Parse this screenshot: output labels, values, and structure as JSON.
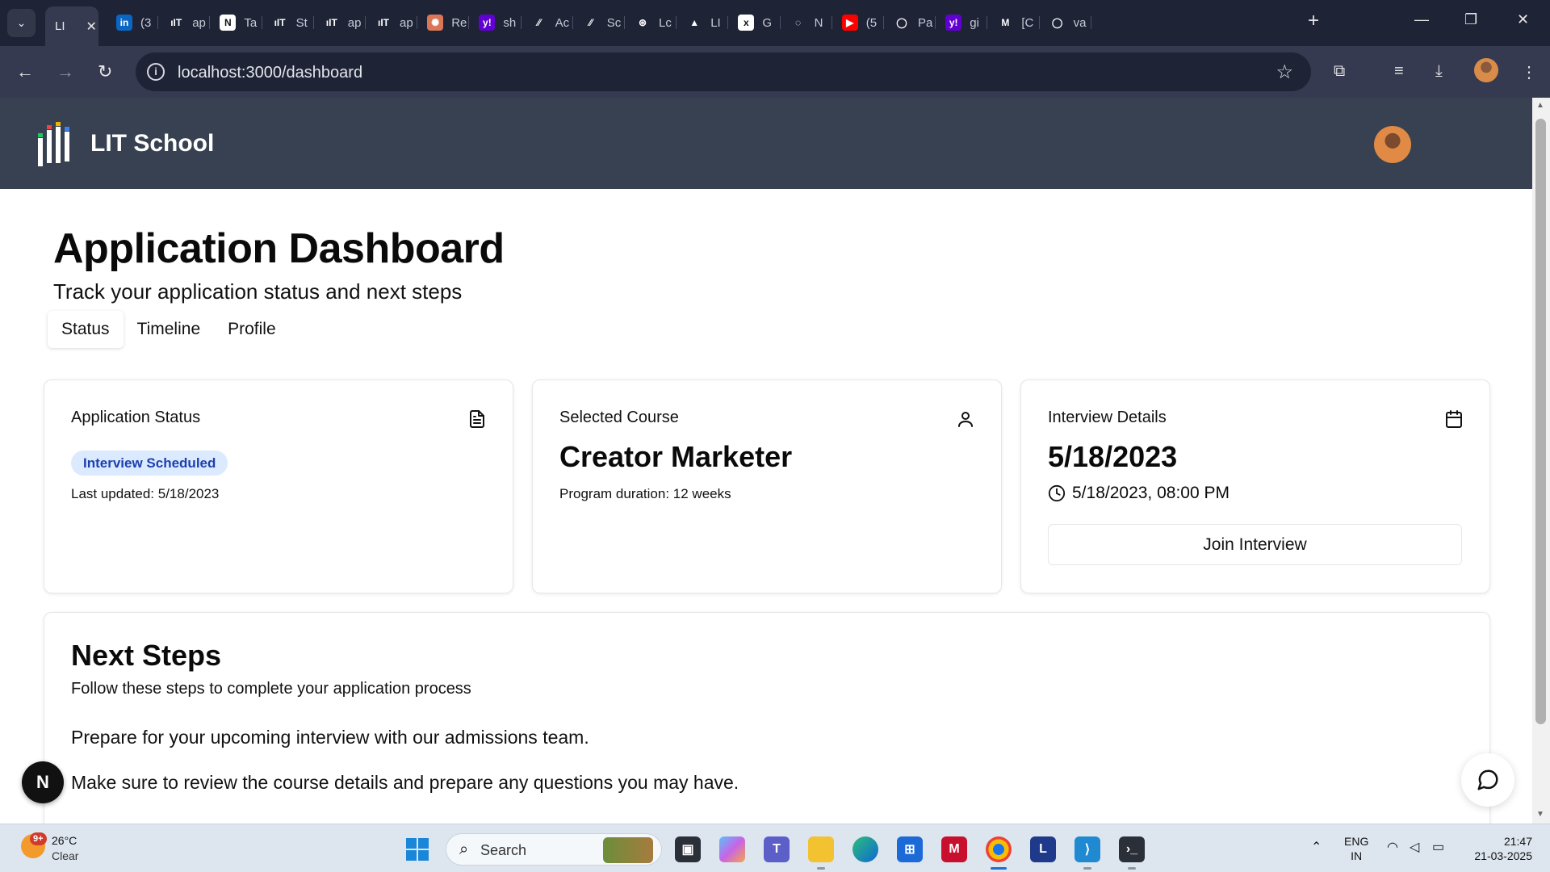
{
  "browser": {
    "active_tab_title": "LI",
    "tabs": [
      {
        "favicon": "linkedin-icon",
        "title": "(3",
        "color": "#0a66c2",
        "glyph": "in"
      },
      {
        "favicon": "lit-icon",
        "title": "ap",
        "color": "#1f2336",
        "glyph": "ıIT"
      },
      {
        "favicon": "notion-icon",
        "title": "Ta",
        "color": "#ffffff",
        "glyph": "N"
      },
      {
        "favicon": "lit-icon",
        "title": "St",
        "color": "#1f2336",
        "glyph": "ıIT"
      },
      {
        "favicon": "lit-icon",
        "title": "ap",
        "color": "#1f2336",
        "glyph": "ıIT"
      },
      {
        "favicon": "lit-icon",
        "title": "ap",
        "color": "#1f2336",
        "glyph": "ıIT"
      },
      {
        "favicon": "claude-icon",
        "title": "Re",
        "color": "#d97757",
        "glyph": "✺"
      },
      {
        "favicon": "yahoo-icon",
        "title": "sh",
        "color": "#6001d2",
        "glyph": "y!"
      },
      {
        "favicon": "slash-icon",
        "title": "Ac",
        "color": "#1f2336",
        "glyph": "⁄⁄"
      },
      {
        "favicon": "slash-icon",
        "title": "Sc",
        "color": "#1f2336",
        "glyph": "⁄⁄"
      },
      {
        "favicon": "openai-icon",
        "title": "Lc",
        "color": "#1f2336",
        "glyph": "⊛"
      },
      {
        "favicon": "vercel-icon",
        "title": "LI",
        "color": "#1f2336",
        "glyph": "▲"
      },
      {
        "favicon": "x-icon",
        "title": "G",
        "color": "#ffffff",
        "glyph": "x"
      },
      {
        "favicon": "ring-icon",
        "title": "N",
        "color": "#1f2336",
        "glyph": "◌"
      },
      {
        "favicon": "youtube-icon",
        "title": "(5",
        "color": "#ff0000",
        "glyph": "▶"
      },
      {
        "favicon": "github-icon",
        "title": "Pa",
        "color": "#1f2336",
        "glyph": "◯"
      },
      {
        "favicon": "yahoo-icon",
        "title": "gi",
        "color": "#6001d2",
        "glyph": "y!"
      },
      {
        "favicon": "gmail-icon",
        "title": "[C",
        "color": "#1f2336",
        "glyph": "M"
      },
      {
        "favicon": "github-icon",
        "title": "va",
        "color": "#1f2336",
        "glyph": "◯"
      }
    ],
    "url": "localhost:3000/dashboard"
  },
  "site": {
    "brand": "LIT School"
  },
  "page": {
    "title": "Application Dashboard",
    "subtitle": "Track your application status and next steps",
    "tabs": [
      {
        "label": "Status",
        "active": true
      },
      {
        "label": "Timeline",
        "active": false
      },
      {
        "label": "Profile",
        "active": false
      }
    ]
  },
  "cards": {
    "status": {
      "label": "Application Status",
      "badge": "Interview Scheduled",
      "updated": "Last updated: 5/18/2023"
    },
    "course": {
      "label": "Selected Course",
      "name": "Creator Marketer",
      "duration": "Program duration: 12 weeks"
    },
    "interview": {
      "label": "Interview Details",
      "date": "5/18/2023",
      "datetime": "5/18/2023, 08:00 PM",
      "button": "Join Interview"
    }
  },
  "next_steps": {
    "title": "Next Steps",
    "subtitle": "Follow these steps to complete your application process",
    "items": [
      "Prepare for your upcoming interview with our admissions team.",
      "Make sure to review the course details and prepare any questions you may have."
    ]
  },
  "overlay": {
    "next_badge": "N"
  },
  "taskbar": {
    "weather_temp": "26°C",
    "weather_desc": "Clear",
    "weather_badge": "9+",
    "search_label": "Search",
    "lang_top": "ENG",
    "lang_bottom": "IN",
    "time": "21:47",
    "date": "21-03-2025"
  },
  "colors": {
    "header_bg": "#374151",
    "badge_bg": "#dbeafe",
    "badge_text": "#1e40af",
    "chrome_dark": "#1f2336",
    "chrome_toolbar": "#353a50"
  }
}
